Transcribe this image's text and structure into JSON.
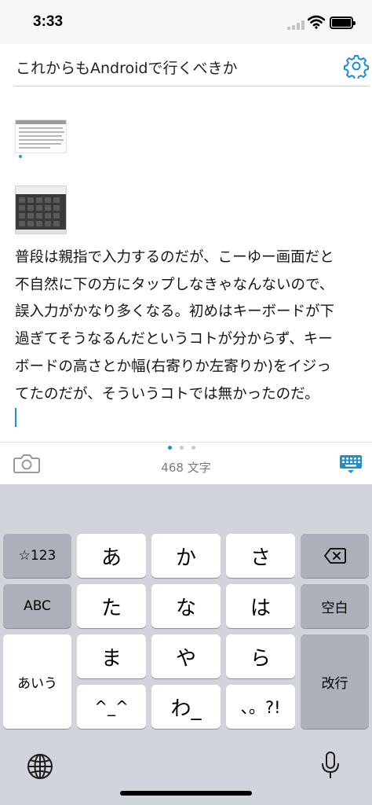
{
  "status_bar": {
    "time": "3:33"
  },
  "editor": {
    "title": "これからもAndroidで行くべきか",
    "body_lines": [
      "普段は親指で入力するのだが、こーゆー画面だと",
      "不自然に下の方にタップしなきゃなんないので、",
      "誤入力がかなり多くなる。初めはキーボードが下",
      "過ぎてそうなるんだというコトが分からず、キー",
      "ボードの高さとか幅(右寄りか左寄りか)をイジっ",
      "てたのだが、そういうコトでは無かったのだ。"
    ],
    "char_count": "468 文字",
    "page_indicator": {
      "count": 3,
      "active": 0
    }
  },
  "icons": {
    "settings": "gear-icon",
    "camera": "camera-icon",
    "keyboard": "keyboard-dismiss-icon",
    "globe": "globe-icon",
    "mic": "microphone-icon",
    "delete": "backspace-icon"
  },
  "colors": {
    "accent": "#1e8fd0",
    "keyboard_bg": "#d1d4db",
    "key_light": "#ffffff",
    "key_dark": "#abb0bb"
  },
  "keyboard": {
    "number_key": "☆123",
    "abc_key": "ABC",
    "kana_key": "あいう",
    "space_key": "空白",
    "return_key": "改行",
    "keys": {
      "a": "あ",
      "ka": "か",
      "sa": "さ",
      "ta": "た",
      "na": "な",
      "ha": "は",
      "ma": "ま",
      "ya": "や",
      "ra": "ら",
      "emoticon": "^_^",
      "wa": "わ_",
      "punct": "、。?!"
    }
  }
}
